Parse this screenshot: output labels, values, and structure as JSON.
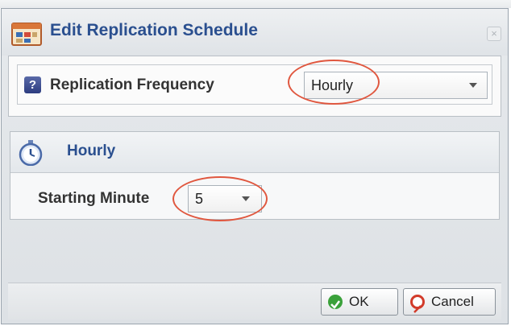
{
  "dialog": {
    "title": "Edit Replication Schedule",
    "close_label": "×"
  },
  "frequency": {
    "help_label": "?",
    "label": "Replication Frequency",
    "selected": "Hourly"
  },
  "hourly_section": {
    "title": "Hourly",
    "starting_minute_label": "Starting Minute",
    "starting_minute_value": "5"
  },
  "buttons": {
    "ok": "OK",
    "cancel": "Cancel"
  },
  "colors": {
    "title": "#2a4f8f",
    "highlight_ring": "#e0573f",
    "ok_icon": "#3aa13a",
    "cancel_icon": "#d23b2a"
  },
  "icons": {
    "title": "schedule-calendar-icon",
    "help": "help-icon",
    "section": "stopwatch-icon",
    "ok": "checkmark-icon",
    "cancel": "cancel-icon"
  }
}
